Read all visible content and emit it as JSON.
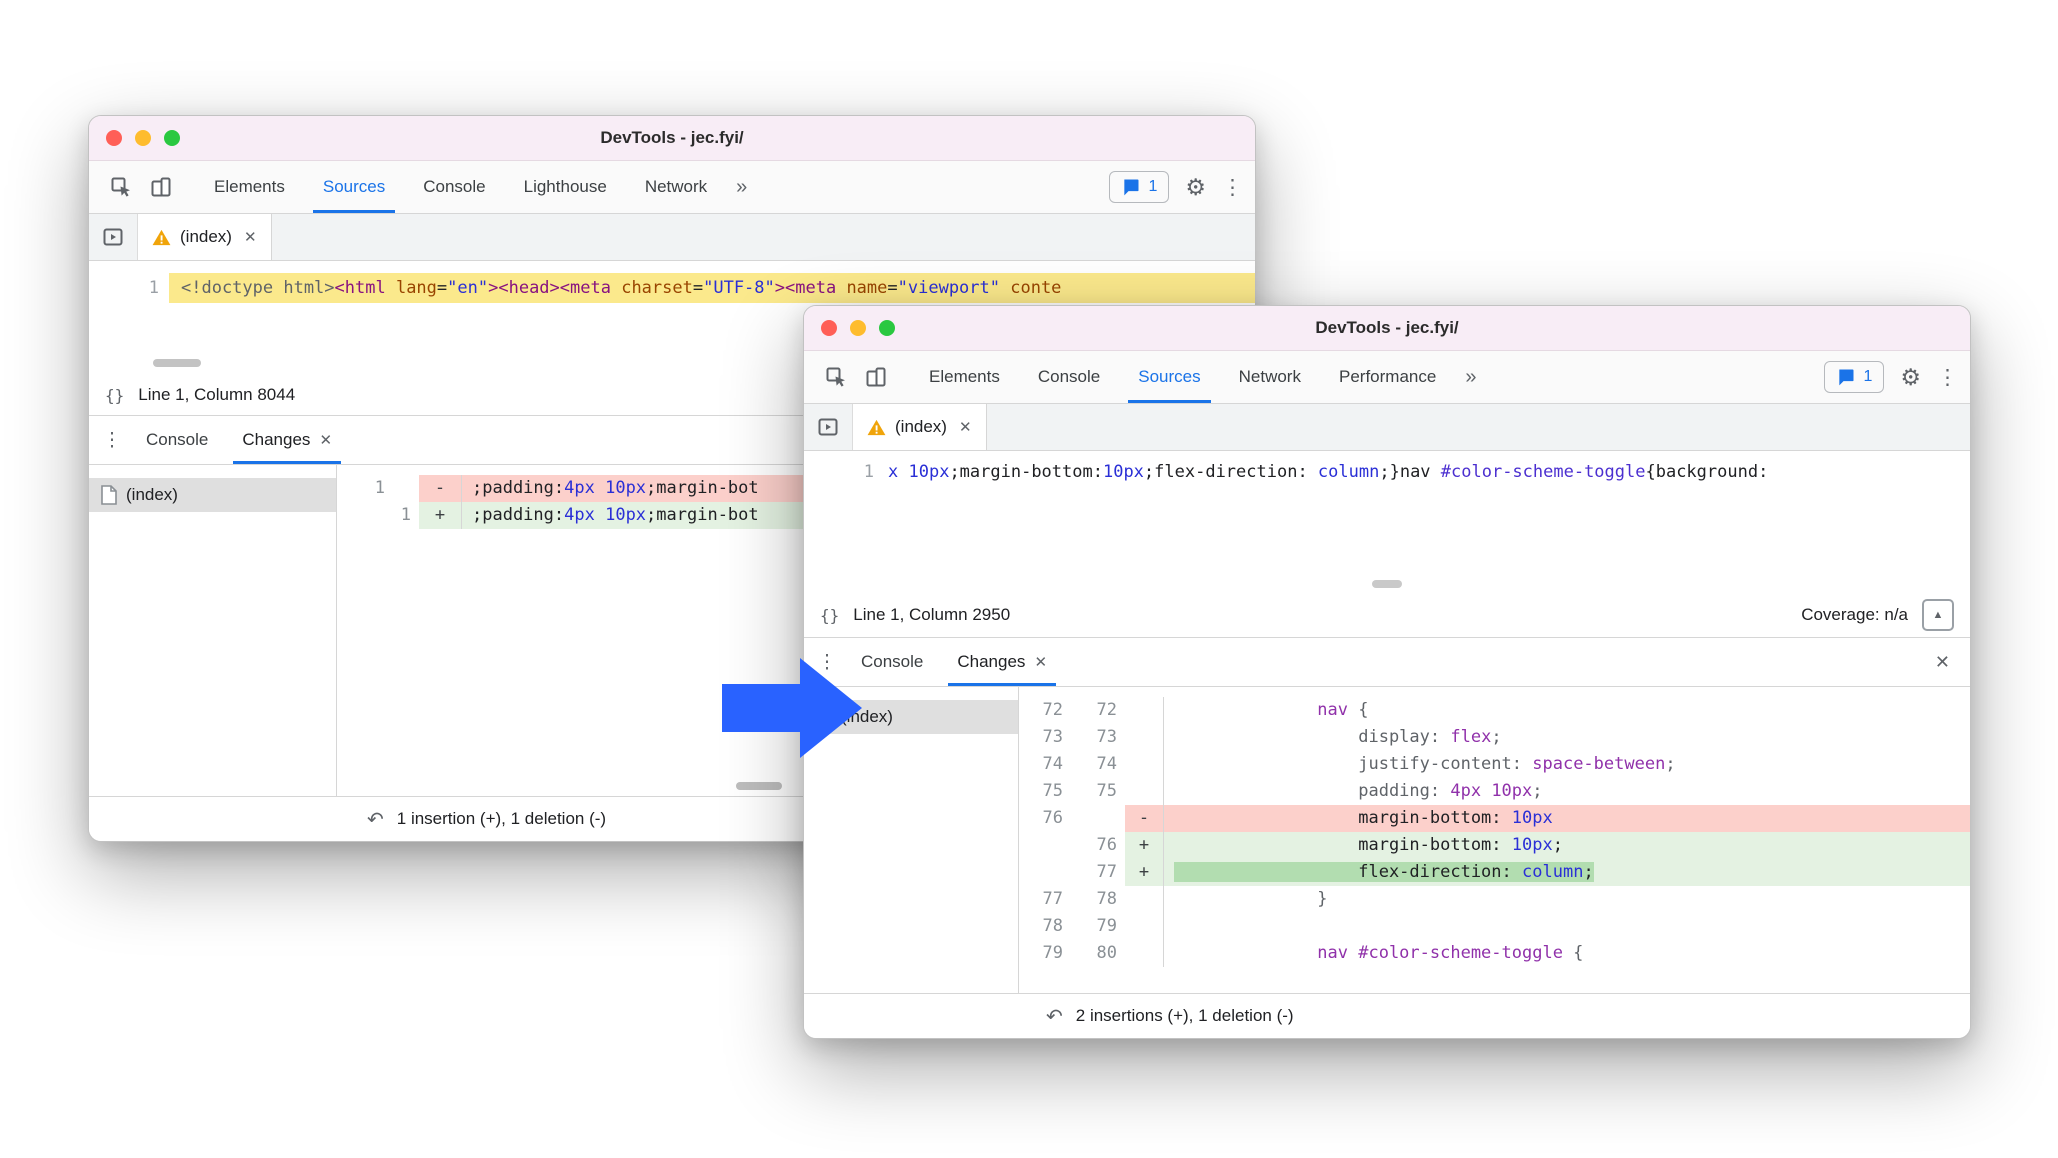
{
  "icons": {
    "gear": "⚙",
    "dots": "⋮",
    "more": "»",
    "close": "✕",
    "undo": "↶",
    "braces": "{}",
    "panel": "▲",
    "drawer_menu": "⋮"
  },
  "arrow": {
    "color": "#2962ff"
  },
  "back_window": {
    "title": "DevTools - jec.fyi/",
    "toolbar_tabs": [
      {
        "label": "Elements"
      },
      {
        "label": "Sources",
        "selected": true
      },
      {
        "label": "Console"
      },
      {
        "label": "Lighthouse"
      },
      {
        "label": "Network"
      }
    ],
    "badge_count": "1",
    "file_tab": "(index)",
    "source_line_number": "1",
    "source_segments": [
      {
        "t": "<!doctype html>",
        "c": "doctype"
      },
      {
        "t": "<html",
        "c": "tag"
      },
      {
        "t": " lang",
        "c": "attr"
      },
      {
        "t": "=",
        "c": "plain"
      },
      {
        "t": "\"en\"",
        "c": "str"
      },
      {
        "t": ">",
        "c": "tag"
      },
      {
        "t": "<head>",
        "c": "tag"
      },
      {
        "t": "<meta",
        "c": "tag"
      },
      {
        "t": " charset",
        "c": "attr"
      },
      {
        "t": "=",
        "c": "plain"
      },
      {
        "t": "\"UTF-8\"",
        "c": "str"
      },
      {
        "t": ">",
        "c": "tag"
      },
      {
        "t": "<meta",
        "c": "tag"
      },
      {
        "t": " name",
        "c": "attr"
      },
      {
        "t": "=",
        "c": "plain"
      },
      {
        "t": "\"viewport\"",
        "c": "str"
      },
      {
        "t": " conte",
        "c": "attr"
      }
    ],
    "status_left": "Line 1, Column 8044",
    "drawer_tabs": [
      {
        "label": "Console"
      },
      {
        "label": "Changes",
        "selected": true,
        "close_glyph": "✕"
      }
    ],
    "file_item": "(index)",
    "diff_rows": [
      {
        "old": "1",
        "new": "",
        "marker": "-",
        "kind": "del",
        "segments": [
          {
            "t": ";padding:",
            "c": "plain"
          },
          {
            "t": "4px",
            "c": "num"
          },
          {
            "t": " ",
            "c": "plain"
          },
          {
            "t": "10px",
            "c": "num"
          },
          {
            "t": ";margin-bot",
            "c": "plain"
          }
        ]
      },
      {
        "old": "",
        "new": "1",
        "marker": "+",
        "kind": "ins",
        "segments": [
          {
            "t": ";padding:",
            "c": "plain"
          },
          {
            "t": "4px",
            "c": "num"
          },
          {
            "t": " ",
            "c": "plain"
          },
          {
            "t": "10px",
            "c": "num"
          },
          {
            "t": ";margin-bot",
            "c": "plain"
          }
        ]
      }
    ],
    "summary": "1 insertion (+), 1 deletion (-)"
  },
  "front_window": {
    "title": "DevTools - jec.fyi/",
    "toolbar_tabs": [
      {
        "label": "Elements"
      },
      {
        "label": "Console"
      },
      {
        "label": "Sources",
        "selected": true
      },
      {
        "label": "Network"
      },
      {
        "label": "Performance"
      }
    ],
    "badge_count": "1",
    "file_tab": "(index)",
    "source_line_number": "1",
    "source_segments": [
      {
        "t": "x ",
        "c": "num"
      },
      {
        "t": "10px",
        "c": "num"
      },
      {
        "t": ";margin-bottom:",
        "c": "plain"
      },
      {
        "t": "10px",
        "c": "num"
      },
      {
        "t": ";flex-direction: ",
        "c": "plain"
      },
      {
        "t": "column",
        "c": "num"
      },
      {
        "t": ";}",
        "c": "plain"
      },
      {
        "t": "nav ",
        "c": "plain"
      },
      {
        "t": "#color-scheme-toggle",
        "c": "id"
      },
      {
        "t": "{background:",
        "c": "plain"
      }
    ],
    "status_left": "Line 1, Column 2950",
    "status_right": "Coverage: n/a",
    "drawer_tabs": [
      {
        "label": "Console"
      },
      {
        "label": "Changes",
        "selected": true,
        "close_glyph": "✕"
      }
    ],
    "file_item": "(index)",
    "diff_rows": [
      {
        "old": "72",
        "new": "72",
        "marker": "",
        "kind": "ctx",
        "segments": [
          {
            "t": "              ",
            "c": "plain"
          },
          {
            "t": "nav",
            "c": "sel"
          },
          {
            "t": " {",
            "c": "prop"
          }
        ]
      },
      {
        "old": "73",
        "new": "73",
        "marker": "",
        "kind": "ctx",
        "segments": [
          {
            "t": "                  ",
            "c": "plain"
          },
          {
            "t": "display:",
            "c": "prop"
          },
          {
            "t": " ",
            "c": "plain"
          },
          {
            "t": "flex",
            "c": "val"
          },
          {
            "t": ";",
            "c": "prop"
          }
        ]
      },
      {
        "old": "74",
        "new": "74",
        "marker": "",
        "kind": "ctx",
        "segments": [
          {
            "t": "                  ",
            "c": "plain"
          },
          {
            "t": "justify-content:",
            "c": "prop"
          },
          {
            "t": " ",
            "c": "plain"
          },
          {
            "t": "space-between",
            "c": "val"
          },
          {
            "t": ";",
            "c": "prop"
          }
        ]
      },
      {
        "old": "75",
        "new": "75",
        "marker": "",
        "kind": "ctx",
        "segments": [
          {
            "t": "                  ",
            "c": "plain"
          },
          {
            "t": "padding:",
            "c": "prop"
          },
          {
            "t": " ",
            "c": "plain"
          },
          {
            "t": "4px 10px",
            "c": "val"
          },
          {
            "t": ";",
            "c": "prop"
          }
        ]
      },
      {
        "old": "76",
        "new": "",
        "marker": "-",
        "kind": "del",
        "segments": [
          {
            "t": "                  ",
            "c": "plain"
          },
          {
            "t": "margin-bottom:",
            "c": "plain"
          },
          {
            "t": " ",
            "c": "plain"
          },
          {
            "t": "10px",
            "c": "num"
          }
        ]
      },
      {
        "old": "",
        "new": "76",
        "marker": "+",
        "kind": "ins",
        "segments": [
          {
            "t": "                  ",
            "c": "plain"
          },
          {
            "t": "margin-bottom:",
            "c": "plain"
          },
          {
            "t": " ",
            "c": "plain"
          },
          {
            "t": "10px",
            "c": "num"
          },
          {
            "t": ";",
            "c": "plain"
          }
        ]
      },
      {
        "old": "",
        "new": "77",
        "marker": "+",
        "kind": "ins2",
        "segments": [
          {
            "t": "                  ",
            "c": "plain"
          },
          {
            "t": "flex-direction:",
            "c": "plain"
          },
          {
            "t": " ",
            "c": "plain"
          },
          {
            "t": "column",
            "c": "num"
          },
          {
            "t": ";",
            "c": "plain"
          }
        ]
      },
      {
        "old": "77",
        "new": "78",
        "marker": "",
        "kind": "ctx",
        "segments": [
          {
            "t": "              ",
            "c": "plain"
          },
          {
            "t": "}",
            "c": "prop"
          }
        ]
      },
      {
        "old": "78",
        "new": "79",
        "marker": "",
        "kind": "ctx",
        "segments": []
      },
      {
        "old": "79",
        "new": "80",
        "marker": "",
        "kind": "ctx",
        "segments": [
          {
            "t": "              ",
            "c": "plain"
          },
          {
            "t": "nav #color-scheme-toggle",
            "c": "sel"
          },
          {
            "t": " {",
            "c": "prop"
          }
        ]
      }
    ],
    "summary": "2 insertions (+), 1 deletion (-)"
  }
}
